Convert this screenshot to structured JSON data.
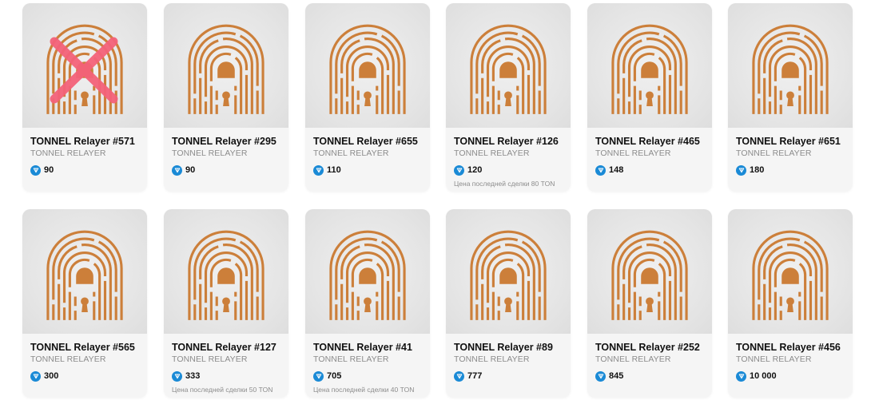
{
  "currency_icon": "ton-diamond-icon",
  "colors": {
    "fingerprint": "#cc7f3a",
    "ton_badge": "#1a8ad6",
    "cross": "#f4627a"
  },
  "cards": [
    {
      "name": "TONNEL Relayer #571",
      "collection": "TONNEL RELAYER",
      "price": "90",
      "last_sale": "",
      "crossed": true
    },
    {
      "name": "TONNEL Relayer #295",
      "collection": "TONNEL RELAYER",
      "price": "90",
      "last_sale": "",
      "crossed": false
    },
    {
      "name": "TONNEL Relayer #655",
      "collection": "TONNEL RELAYER",
      "price": "110",
      "last_sale": "",
      "crossed": false
    },
    {
      "name": "TONNEL Relayer #126",
      "collection": "TONNEL RELAYER",
      "price": "120",
      "last_sale": "Цена последней сделки 80 TON",
      "crossed": false
    },
    {
      "name": "TONNEL Relayer #465",
      "collection": "TONNEL RELAYER",
      "price": "148",
      "last_sale": "",
      "crossed": false
    },
    {
      "name": "TONNEL Relayer #651",
      "collection": "TONNEL RELAYER",
      "price": "180",
      "last_sale": "",
      "crossed": false
    },
    {
      "name": "TONNEL Relayer #565",
      "collection": "TONNEL RELAYER",
      "price": "300",
      "last_sale": "",
      "crossed": false
    },
    {
      "name": "TONNEL Relayer #127",
      "collection": "TONNEL RELAYER",
      "price": "333",
      "last_sale": "Цена последней сделки 50 TON",
      "crossed": false
    },
    {
      "name": "TONNEL Relayer #41",
      "collection": "TONNEL RELAYER",
      "price": "705",
      "last_sale": "Цена последней сделки 40 TON",
      "crossed": false
    },
    {
      "name": "TONNEL Relayer #89",
      "collection": "TONNEL RELAYER",
      "price": "777",
      "last_sale": "",
      "crossed": false
    },
    {
      "name": "TONNEL Relayer #252",
      "collection": "TONNEL RELAYER",
      "price": "845",
      "last_sale": "",
      "crossed": false
    },
    {
      "name": "TONNEL Relayer #456",
      "collection": "TONNEL RELAYER",
      "price": "10 000",
      "last_sale": "",
      "crossed": false
    }
  ]
}
